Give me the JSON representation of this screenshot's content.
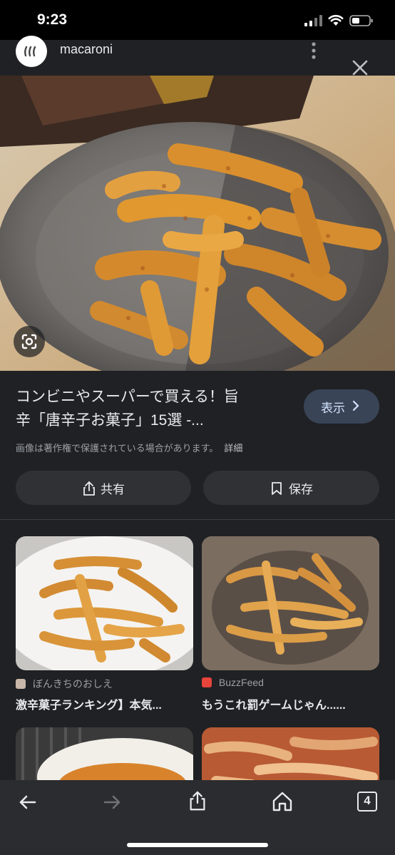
{
  "status_bar": {
    "time": "9:23"
  },
  "header": {
    "site_name": "macaroni"
  },
  "hero": {
    "alt": "唐辛子お菓子"
  },
  "result": {
    "title_line1": "コンビニやスーパーで買える！旨",
    "title_line2": "辛「唐辛子お菓子」15選 -...",
    "visit_label": "表示",
    "copyright": "画像は著作権で保護されている場合があります。",
    "detail_label": "詳細",
    "share_label": "共有",
    "save_label": "保存"
  },
  "related": [
    {
      "source": "ぼんきちのおしえ",
      "title": "激辛菓子ランキング】本気..."
    },
    {
      "source": "BuzzFeed",
      "title": "もうこれ罰ゲームじゃん......"
    }
  ],
  "toolbar": {
    "tab_count": "4"
  },
  "colors": {
    "background": "#202124",
    "button_fill": "#303134",
    "visit_button": "#394457",
    "accent_text": "#d2e3fc"
  },
  "icons": [
    "back-arrow-icon",
    "forward-arrow-icon",
    "share-icon",
    "home-icon",
    "tabs-icon",
    "bookmark-icon",
    "close-icon",
    "more-vert-icon",
    "lens-icon",
    "chevron-right-icon"
  ]
}
